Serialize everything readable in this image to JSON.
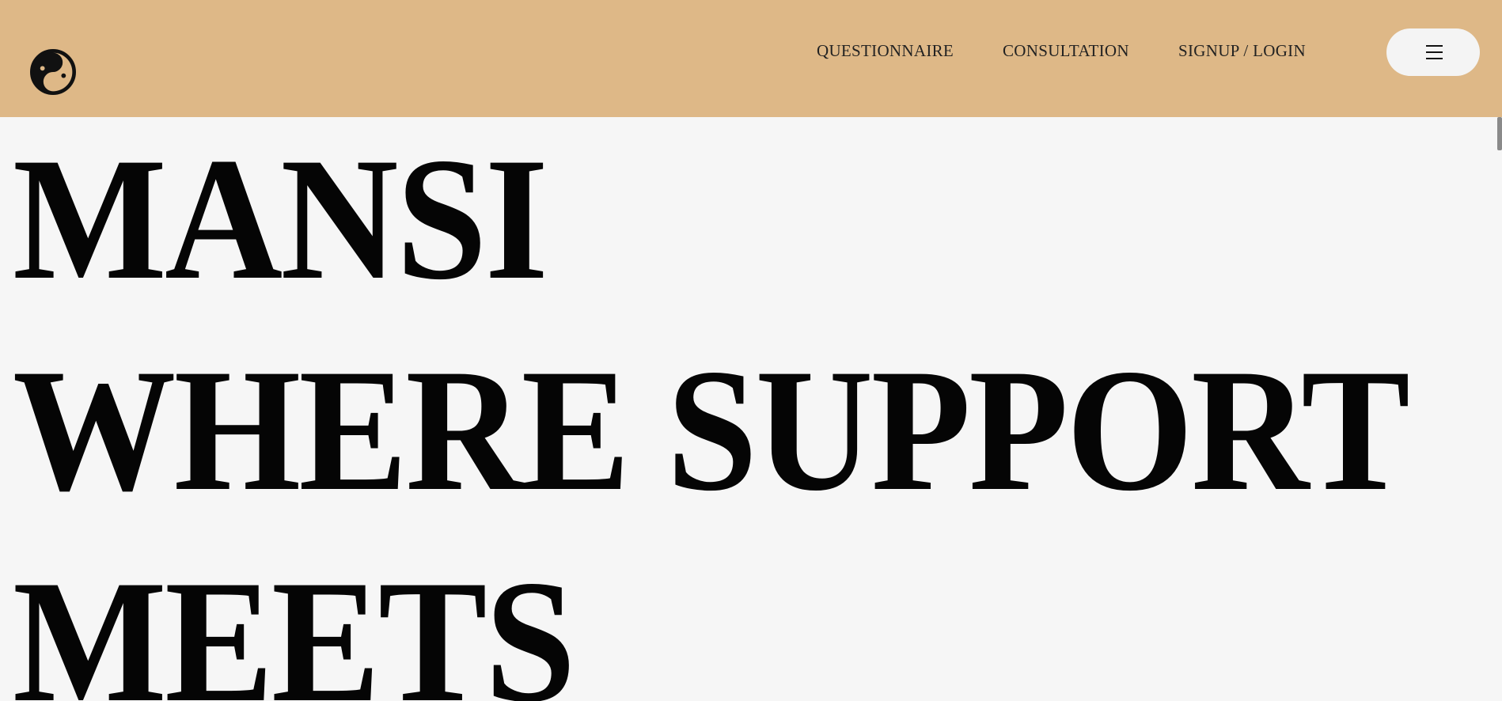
{
  "header": {
    "background": "#deb887",
    "logo": {
      "icon": "yin-yang-icon"
    },
    "nav": [
      {
        "label": "QUESTIONNAIRE"
      },
      {
        "label": "CONSULTATION"
      },
      {
        "label": "SIGNUP / LOGIN"
      }
    ],
    "menu_button": {
      "icon": "hamburger-menu-icon"
    }
  },
  "hero": {
    "lines": [
      "MANSI",
      "WHERE SUPPORT",
      "MEETS"
    ]
  }
}
